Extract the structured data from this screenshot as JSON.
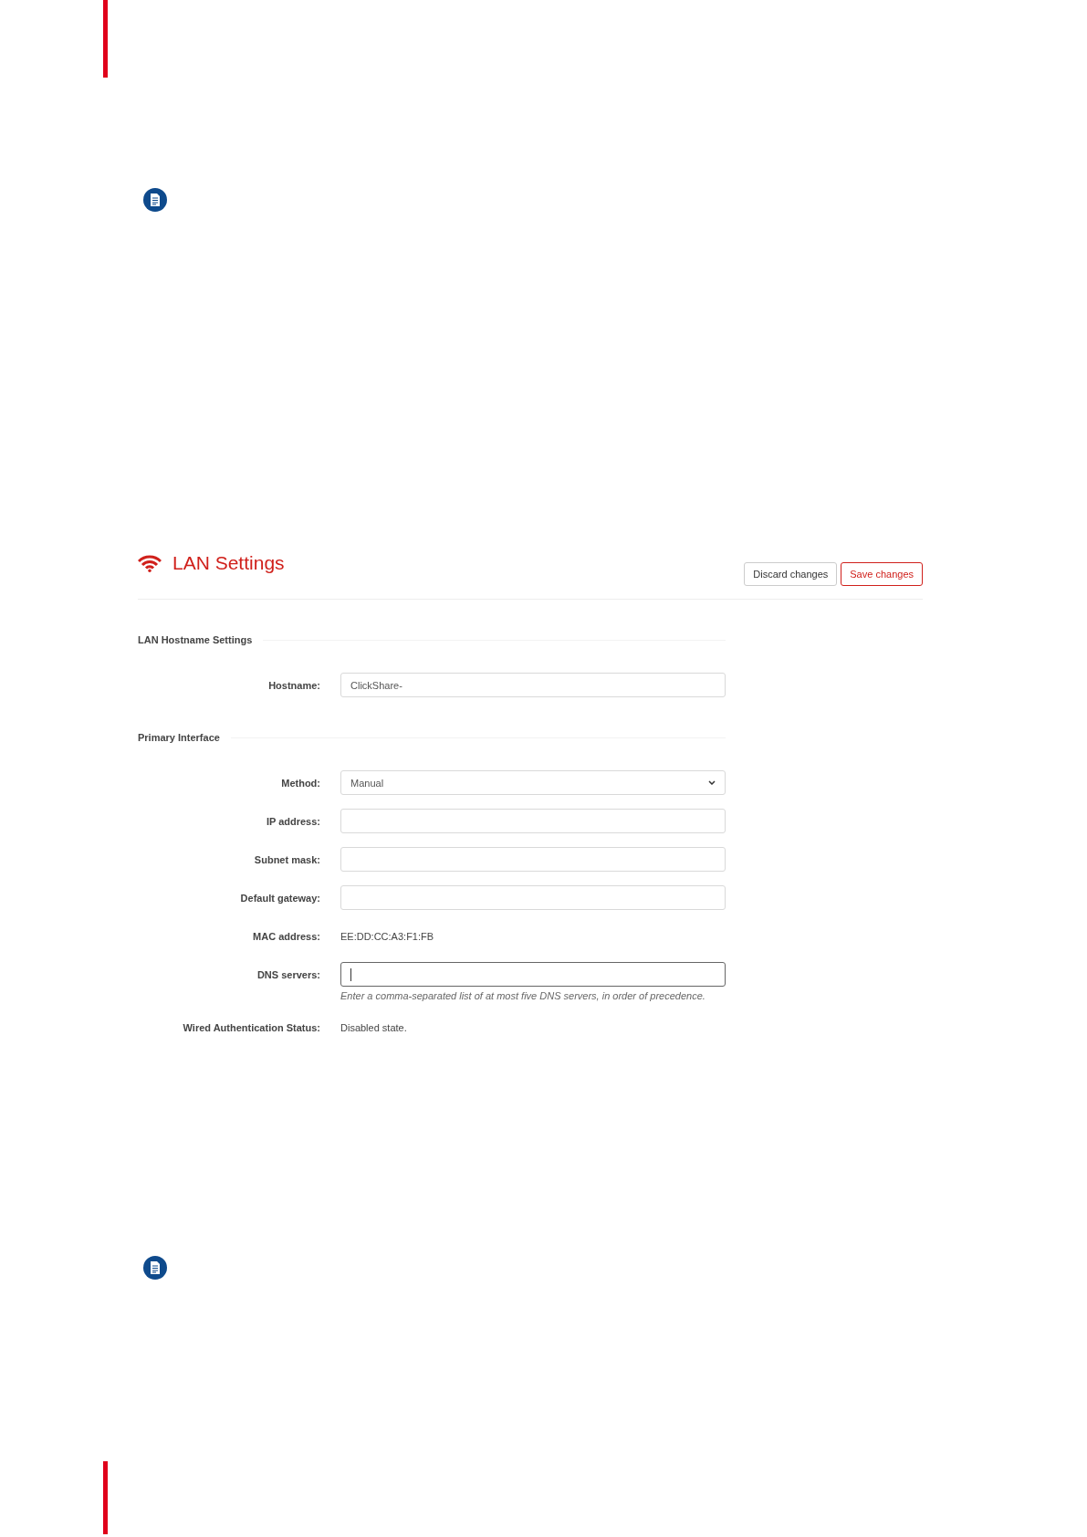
{
  "settings": {
    "title": "LAN Settings",
    "buttons": [
      {
        "label": "Discard changes",
        "kind": "default"
      },
      {
        "label": "Save changes",
        "kind": "primary"
      }
    ],
    "sections": [
      {
        "title": "LAN Hostname Settings",
        "fields": [
          {
            "label": "Hostname:",
            "kind": "input",
            "value": "ClickShare-",
            "focused": false
          }
        ]
      },
      {
        "title": "Primary Interface",
        "fields": [
          {
            "label": "Method:",
            "kind": "select",
            "value": "Manual"
          },
          {
            "label": "IP address:",
            "kind": "input",
            "focused": false
          },
          {
            "label": "Subnet mask:",
            "kind": "input",
            "focused": false
          },
          {
            "label": "Default gateway:",
            "kind": "input",
            "focused": false
          },
          {
            "label": "MAC address:",
            "kind": "text",
            "value": "EE:DD:CC:A3:F1:FB"
          },
          {
            "label": "DNS servers:",
            "kind": "input",
            "focused": true,
            "hint": "Enter a comma-separated list of at most five DNS servers, in order of precedence."
          },
          {
            "label": "Wired Authentication Status:",
            "kind": "text",
            "value": "Disabled state."
          }
        ]
      }
    ]
  }
}
